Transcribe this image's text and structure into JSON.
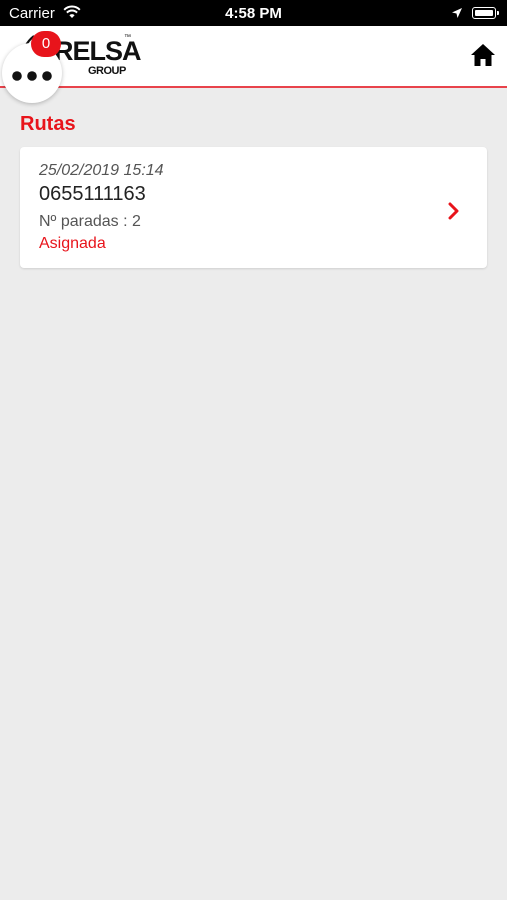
{
  "status_bar": {
    "carrier": "Carrier",
    "time": "4:58 PM",
    "icons": [
      "wifi-icon",
      "location-arrow-icon",
      "battery-icon"
    ]
  },
  "header": {
    "logo_text": "RELSA",
    "logo_tm": "™",
    "logo_subtext": "GROUP",
    "home_icon": "home-icon"
  },
  "fab": {
    "icon": "more-dots-icon",
    "badge_count": "0"
  },
  "section_title": "Rutas",
  "routes": [
    {
      "datetime": "25/02/2019 15:14",
      "code": "0655111163",
      "stops_label": "Nº paradas : 2",
      "status": "Asignada"
    }
  ],
  "colors": {
    "accent": "#e8141b",
    "background": "#ececec",
    "card": "#ffffff"
  }
}
